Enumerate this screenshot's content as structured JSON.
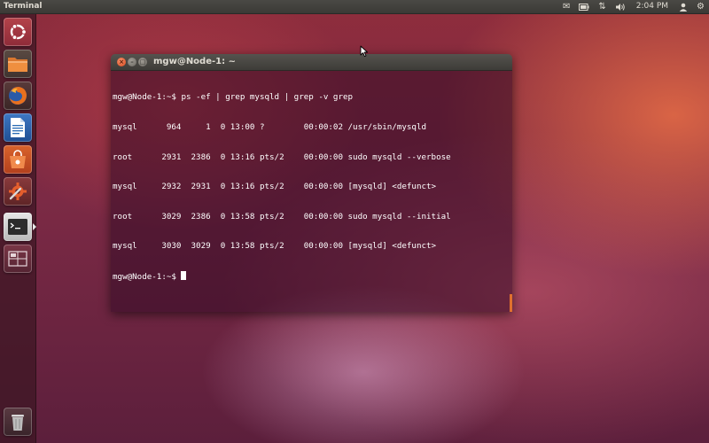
{
  "panel": {
    "app_title": "Terminal",
    "indicators": [
      {
        "name": "mail-icon",
        "glyph": "✉"
      },
      {
        "name": "battery-icon",
        "glyph": "▭"
      },
      {
        "name": "network-icon",
        "glyph": "⇅"
      },
      {
        "name": "volume-icon",
        "glyph": "🔈"
      }
    ],
    "clock": "2:04 PM",
    "user_glyph": "👤",
    "settings_glyph": "⚙"
  },
  "launcher": {
    "items": [
      {
        "name": "ubuntu-dash-icon",
        "label": "Dash",
        "color": "#e9663a"
      },
      {
        "name": "files-icon",
        "label": "Files",
        "color": "#d2762a"
      },
      {
        "name": "firefox-icon",
        "label": "Firefox",
        "color": "#e07b22"
      },
      {
        "name": "libreoffice-writer-icon",
        "label": "Writer",
        "color": "#2a6cb5"
      },
      {
        "name": "software-center-icon",
        "label": "Software Center",
        "color": "#dd5a28"
      },
      {
        "name": "system-settings-icon",
        "label": "System Settings",
        "color": "#c2432a"
      },
      {
        "name": "terminal-icon",
        "label": "Terminal",
        "color": "#2c2c2c"
      },
      {
        "name": "workspace-switcher-icon",
        "label": "Workspaces",
        "color": "#8a3a4a"
      }
    ],
    "trash": {
      "name": "trash-icon",
      "label": "Trash"
    }
  },
  "terminal": {
    "title": "mgw@Node-1: ~",
    "lines": [
      "mgw@Node-1:~$ ps -ef | grep mysqld | grep -v grep",
      "mysql      964     1  0 13:00 ?        00:00:02 /usr/sbin/mysqld",
      "root      2931  2386  0 13:16 pts/2    00:00:00 sudo mysqld --verbose",
      "mysql     2932  2931  0 13:16 pts/2    00:00:00 [mysqld] <defunct>",
      "root      3029  2386  0 13:58 pts/2    00:00:00 sudo mysqld --initial",
      "mysql     3030  3029  0 13:58 pts/2    00:00:00 [mysqld] <defunct>"
    ],
    "prompt": "mgw@Node-1:~$ "
  },
  "colors": {
    "accent": "#e0702e",
    "panel": "#3c3b37"
  }
}
